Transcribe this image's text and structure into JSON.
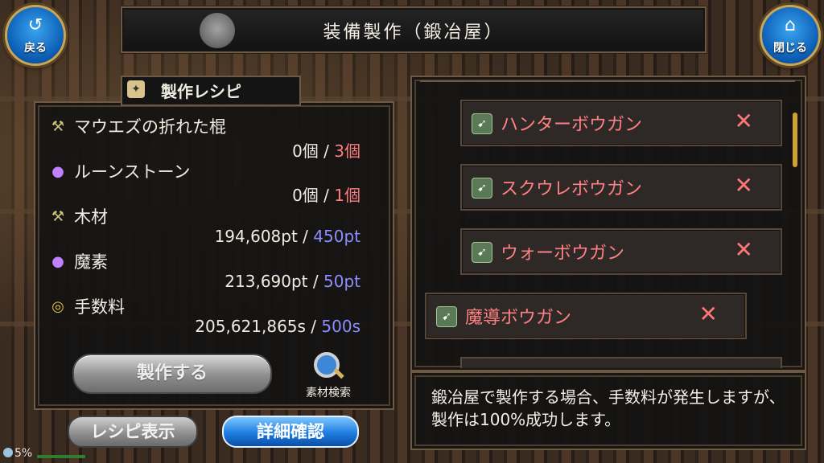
{
  "window": {
    "title": "装備製作（鍛冶屋）"
  },
  "nav": {
    "back": {
      "label": "戻る",
      "icon": "back-arrow-icon"
    },
    "close": {
      "label": "閉じる",
      "icon": "home-icon"
    }
  },
  "recipe": {
    "title": "製作レシピ",
    "materials": [
      {
        "name": "マウエズの折れた棍",
        "icon": "staff-icon",
        "have": "0個",
        "sep": "/",
        "need": "3個",
        "need_color": "red"
      },
      {
        "name": "ルーンストーン",
        "icon": "rune-orb-icon",
        "have": "0個",
        "sep": "/",
        "need": "1個",
        "need_color": "red"
      },
      {
        "name": "木材",
        "icon": "wood-icon",
        "have": "194,608pt",
        "sep": "/",
        "need": "450pt",
        "need_color": "blue"
      },
      {
        "name": "魔素",
        "icon": "mana-orb-icon",
        "have": "213,690pt",
        "sep": "/",
        "need": "50pt",
        "need_color": "blue"
      },
      {
        "name": "手数料",
        "icon": "coin-icon",
        "have": "205,621,865s",
        "sep": "/",
        "need": "500s",
        "need_color": "blue"
      }
    ],
    "make_button": "製作する",
    "search_label": "素材検索"
  },
  "bottom_buttons": {
    "recipe_view": "レシピ表示",
    "detail": "詳細確認"
  },
  "equipment_list": [
    {
      "name": "ハンターボウガン",
      "mark": "✕"
    },
    {
      "name": "スクウレボウガン",
      "mark": "✕"
    },
    {
      "name": "ウォーボウガン",
      "mark": "✕"
    },
    {
      "name": "魔導ボウガン",
      "mark": "✕"
    }
  ],
  "message": "鍛冶屋で製作する場合、手数料が発生しますが、製作は100%成功します。",
  "status": {
    "percent": "5%"
  },
  "colors": {
    "red": "#ff7d7d",
    "blue": "#8d8dff",
    "gold": "#c9a557"
  }
}
